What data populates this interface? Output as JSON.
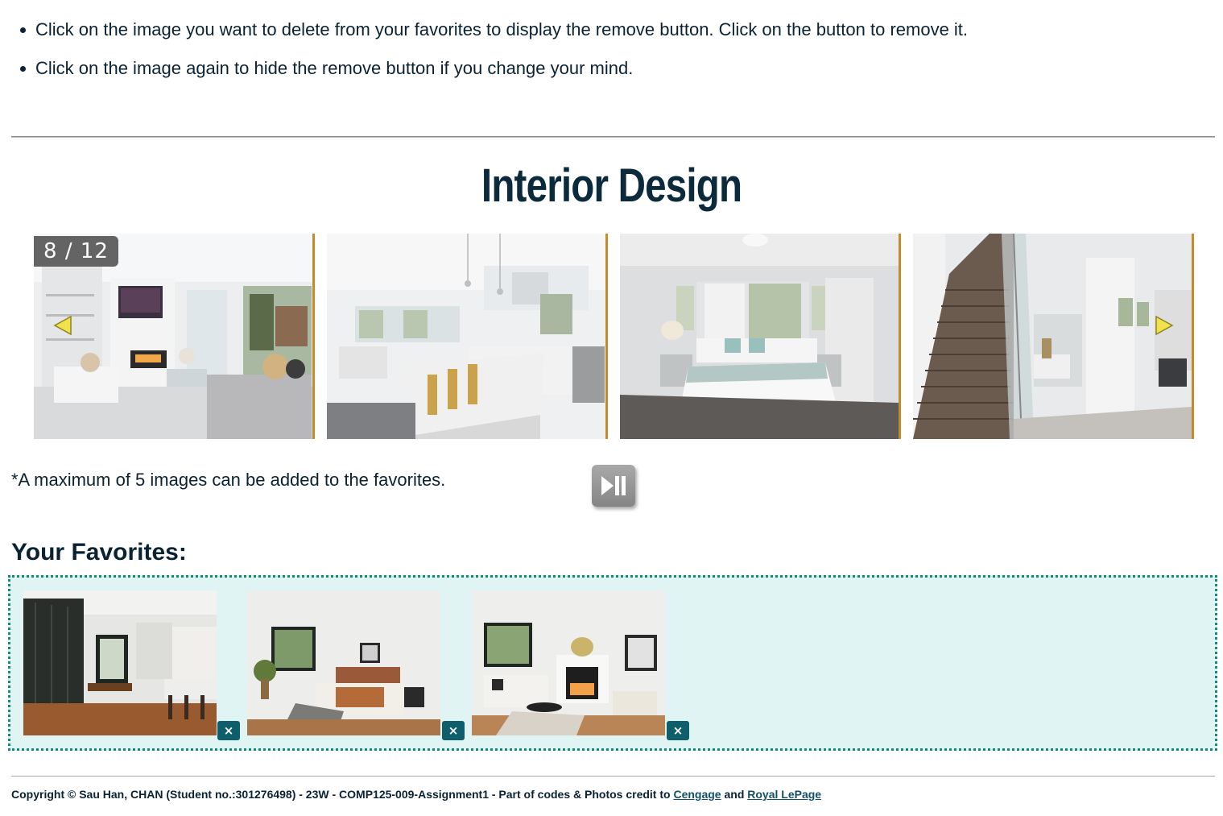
{
  "instructions": [
    "Click on the image you want to delete from your favorites to display the remove button. Click on the button to remove it.",
    "Click on the image again to hide the remove button if you change your mind."
  ],
  "title": "Interior Design",
  "carousel": {
    "counter": "8 / 12",
    "slides": [
      {
        "alt": "living room with fireplace"
      },
      {
        "alt": "kitchen with island"
      },
      {
        "alt": "bedroom"
      },
      {
        "alt": "staircase"
      }
    ],
    "prev_icon": "chevron-left-icon",
    "next_icon": "chevron-right-icon",
    "arrow_color": "#f0e24a"
  },
  "note": "*A maximum of 5 images can be added to the favorites.",
  "play_pause_icon": "play-pause-icon",
  "favorites": {
    "heading": "Your Favorites:",
    "items": [
      {
        "alt": "dining room and kitchen",
        "remove_label": "×"
      },
      {
        "alt": "bedroom",
        "remove_label": "×"
      },
      {
        "alt": "living room",
        "remove_label": "×"
      }
    ]
  },
  "footer": {
    "text": "Copyright © Sau Han, CHAN (Student no.:301276498) - 23W - COMP125-009-Assignment1 - Part of codes & Photos credit to",
    "link1": "Cengage",
    "and": "and",
    "link2": "Royal LePage"
  },
  "colors": {
    "title": "#0b2a3b",
    "accent_border": "#c48a2c",
    "favorites_bg": "#e0f5f3",
    "favorites_border": "#138a78",
    "remove_button": "#0e5f6b"
  }
}
